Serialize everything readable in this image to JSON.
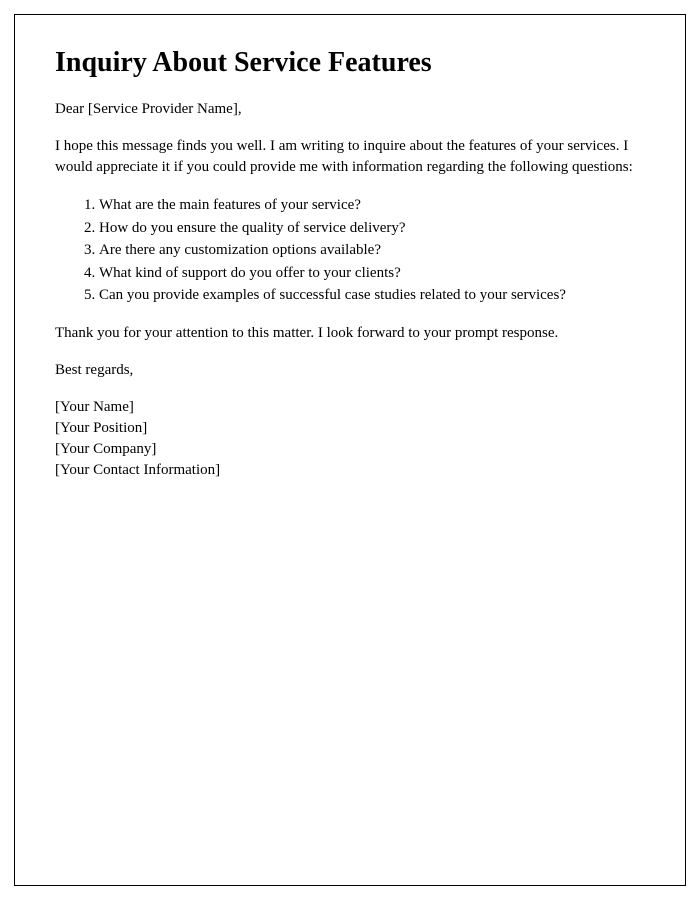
{
  "title": "Inquiry About Service Features",
  "salutation": "Dear [Service Provider Name],",
  "intro": "I hope this message finds you well. I am writing to inquire about the features of your services. I would appreciate it if you could provide me with information regarding the following questions:",
  "questions": [
    "What are the main features of your service?",
    "How do you ensure the quality of service delivery?",
    "Are there any customization options available?",
    "What kind of support do you offer to your clients?",
    "Can you provide examples of successful case studies related to your services?"
  ],
  "closing": "Thank you for your attention to this matter. I look forward to your prompt response.",
  "signoff": "Best regards,",
  "signature": {
    "name": "[Your Name]",
    "position": "[Your Position]",
    "company": "[Your Company]",
    "contact": "[Your Contact Information]"
  }
}
